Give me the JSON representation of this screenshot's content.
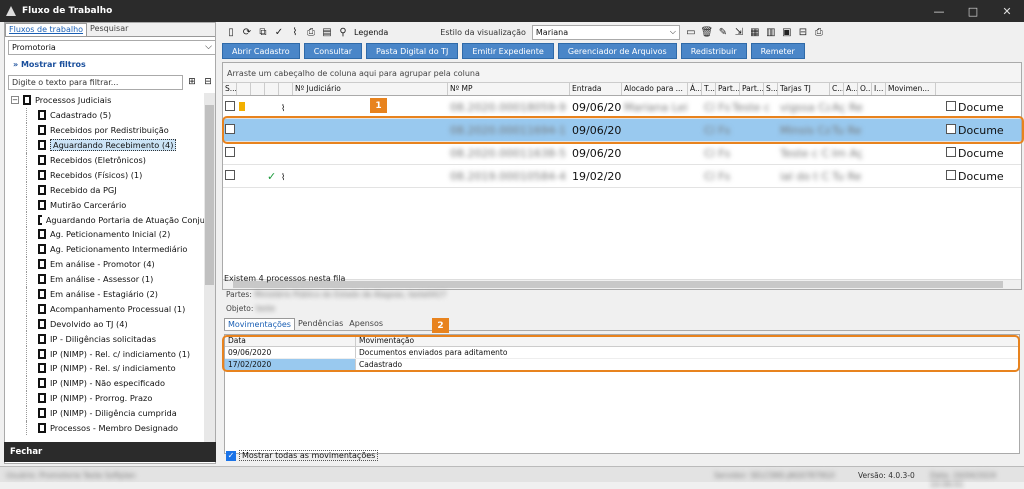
{
  "window": {
    "title": "Fluxo de Trabalho",
    "controls": [
      "—",
      "□",
      "✕"
    ]
  },
  "left": {
    "tabs": [
      "Fluxos de trabalho",
      "Pesquisar"
    ],
    "combo_value": "Promotoria",
    "show_filters": "Mostrar filtros",
    "search_placeholder": "Digite o texto para filtrar...",
    "tree": [
      {
        "label": "Processos Judiciais",
        "level": 0
      },
      {
        "label": "Cadastrado (5)",
        "level": 1
      },
      {
        "label": "Recebidos por Redistribuição",
        "level": 1
      },
      {
        "label": "Aguardando Recebimento (4)",
        "level": 1,
        "selected": true
      },
      {
        "label": "Recebidos (Eletrônicos)",
        "level": 1
      },
      {
        "label": "Recebidos (Físicos) (1)",
        "level": 1
      },
      {
        "label": "Recebido da PGJ",
        "level": 1
      },
      {
        "label": "Mutirão Carcerário",
        "level": 1
      },
      {
        "label": "Aguardando Portaria de Atuação Conju",
        "level": 1
      },
      {
        "label": "Ag. Peticionamento Inicial (2)",
        "level": 1
      },
      {
        "label": "Ag. Peticionamento Intermediário",
        "level": 1
      },
      {
        "label": "Em análise - Promotor (4)",
        "level": 1
      },
      {
        "label": "Em análise - Assessor (1)",
        "level": 1
      },
      {
        "label": "Em análise - Estagiário (2)",
        "level": 1
      },
      {
        "label": "Acompanhamento Processual (1)",
        "level": 1
      },
      {
        "label": "Devolvido ao TJ (4)",
        "level": 1
      },
      {
        "label": "IP - Diligências solicitadas",
        "level": 1
      },
      {
        "label": "IP (NIMP) - Rel. c/ indiciamento (1)",
        "level": 1
      },
      {
        "label": "IP (NIMP) - Rel. s/ indiciamento",
        "level": 1
      },
      {
        "label": "IP (NIMP) - Não especificado",
        "level": 1
      },
      {
        "label": "IP (NIMP) - Prorrog. Prazo",
        "level": 1
      },
      {
        "label": "IP (NIMP) - Diligência cumprida",
        "level": 1
      },
      {
        "label": "Processos - Membro Designado",
        "level": 1
      }
    ],
    "close_button": "Fechar"
  },
  "toolbar": {
    "legend": "Legenda",
    "style_label": "Estilo da visualização",
    "style_value": "Mariana"
  },
  "actions": [
    "Abrir Cadastro",
    "Consultar",
    "Pasta Digital do TJ",
    "Emitir Expediente",
    "Gerenciador de Arquivos",
    "Redistribuir",
    "Remeter"
  ],
  "grid": {
    "group_hint": "Arraste um cabeçalho de coluna aqui para agrupar pela coluna",
    "headers": [
      "S...",
      "",
      "",
      "",
      "",
      "Nº Judiciário",
      "Nº MP",
      "Entrada",
      "Alocado para ...",
      "Á...",
      "T...",
      "Part...",
      "Part...",
      "S...",
      "Tarjas TJ",
      "C...",
      "A...",
      "O...",
      "I...",
      "Movimen..."
    ],
    "rows": [
      {
        "mp": "08.2020.00018059-9",
        "entrada": "09/06/20",
        "alocado": "Mariana Leite",
        "a": "Cí Fs",
        "part1": "Teste c",
        "part2": "vigssa Ca",
        "tarjas": "Aç Re",
        "mov": "Documen",
        "flag": true,
        "clip": true
      },
      {
        "mp": "08.2020.00011694-1",
        "entrada": "09/06/20",
        "alocado": "",
        "a": "Cí Fs",
        "part1": "",
        "part2": "Minsis Ca",
        "tarjas": "Tu Re",
        "mov": "Documen",
        "selected": true
      },
      {
        "mp": "08.2020.00011638-5",
        "entrada": "09/06/20",
        "alocado": "",
        "a": "Cí Fs",
        "part1": "",
        "part2": "Teste c Ca",
        "tarjas": "Im Aç",
        "mov": "Documen"
      },
      {
        "mp": "08.2019.00010584-4",
        "entrada": "19/02/20",
        "alocado": "",
        "a": "Cí Fs",
        "part1": "",
        "part2": "ial do t Ca",
        "tarjas": "Tu Re",
        "mov": "Documen",
        "check": true,
        "clip": true
      }
    ]
  },
  "count_text": "Existem 4 processos nesta fila",
  "parts_label": "Partes:",
  "parts_value": "Ministério Público do Estado de Alagoas, teste0427",
  "object_label": "Objeto:",
  "object_value": "teste",
  "bottom_tabs": [
    "Movimentações",
    "Pendências",
    "Apensos"
  ],
  "movements": {
    "headers": [
      "Data",
      "Movimentação"
    ],
    "rows": [
      {
        "date": "09/06/2020",
        "text": "Documentos enviados para aditamento"
      },
      {
        "date": "17/02/2020",
        "text": "Cadastrado",
        "selected": true
      }
    ]
  },
  "show_all": "Mostrar todas as movimentações",
  "badges": [
    "1",
    "2"
  ],
  "status": {
    "left": "Usuário: Promotoria Teste Softplan",
    "server": "Servidor: SELCSNS-JAG07879G/I",
    "version": "Versão: 4.0.3-0",
    "date": "Data: 24/04/2024 10:06:01"
  },
  "colors": {
    "accent": "#4a86c8",
    "titlebar": "#2b2b2b",
    "callout": "#e8831e",
    "selection": "#99c9ef"
  }
}
